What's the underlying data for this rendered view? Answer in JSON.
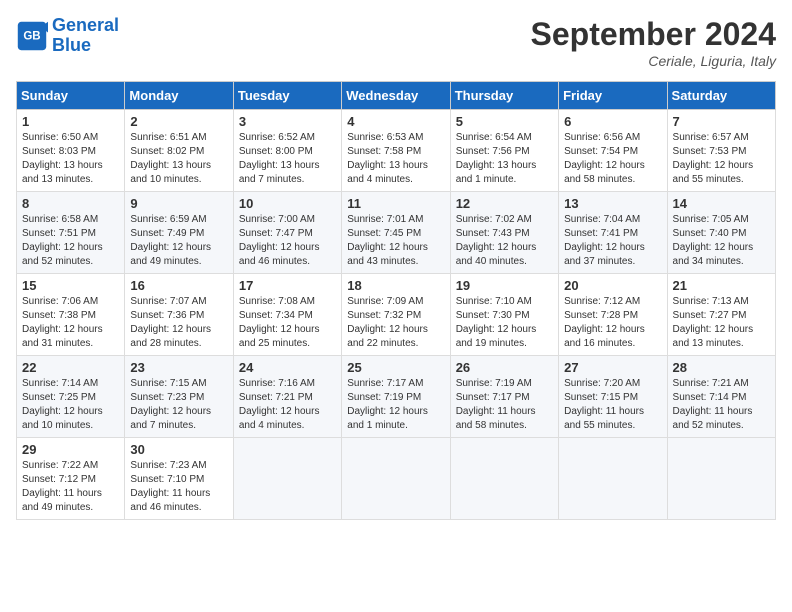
{
  "logo": {
    "line1": "General",
    "line2": "Blue"
  },
  "title": "September 2024",
  "location": "Ceriale, Liguria, Italy",
  "days_of_week": [
    "Sunday",
    "Monday",
    "Tuesday",
    "Wednesday",
    "Thursday",
    "Friday",
    "Saturday"
  ],
  "weeks": [
    [
      {
        "day": "1",
        "rise": "6:50 AM",
        "set": "8:03 PM",
        "daylight": "13 hours and 13 minutes."
      },
      {
        "day": "2",
        "rise": "6:51 AM",
        "set": "8:02 PM",
        "daylight": "13 hours and 10 minutes."
      },
      {
        "day": "3",
        "rise": "6:52 AM",
        "set": "8:00 PM",
        "daylight": "13 hours and 7 minutes."
      },
      {
        "day": "4",
        "rise": "6:53 AM",
        "set": "7:58 PM",
        "daylight": "13 hours and 4 minutes."
      },
      {
        "day": "5",
        "rise": "6:54 AM",
        "set": "7:56 PM",
        "daylight": "13 hours and 1 minute."
      },
      {
        "day": "6",
        "rise": "6:56 AM",
        "set": "7:54 PM",
        "daylight": "12 hours and 58 minutes."
      },
      {
        "day": "7",
        "rise": "6:57 AM",
        "set": "7:53 PM",
        "daylight": "12 hours and 55 minutes."
      }
    ],
    [
      {
        "day": "8",
        "rise": "6:58 AM",
        "set": "7:51 PM",
        "daylight": "12 hours and 52 minutes."
      },
      {
        "day": "9",
        "rise": "6:59 AM",
        "set": "7:49 PM",
        "daylight": "12 hours and 49 minutes."
      },
      {
        "day": "10",
        "rise": "7:00 AM",
        "set": "7:47 PM",
        "daylight": "12 hours and 46 minutes."
      },
      {
        "day": "11",
        "rise": "7:01 AM",
        "set": "7:45 PM",
        "daylight": "12 hours and 43 minutes."
      },
      {
        "day": "12",
        "rise": "7:02 AM",
        "set": "7:43 PM",
        "daylight": "12 hours and 40 minutes."
      },
      {
        "day": "13",
        "rise": "7:04 AM",
        "set": "7:41 PM",
        "daylight": "12 hours and 37 minutes."
      },
      {
        "day": "14",
        "rise": "7:05 AM",
        "set": "7:40 PM",
        "daylight": "12 hours and 34 minutes."
      }
    ],
    [
      {
        "day": "15",
        "rise": "7:06 AM",
        "set": "7:38 PM",
        "daylight": "12 hours and 31 minutes."
      },
      {
        "day": "16",
        "rise": "7:07 AM",
        "set": "7:36 PM",
        "daylight": "12 hours and 28 minutes."
      },
      {
        "day": "17",
        "rise": "7:08 AM",
        "set": "7:34 PM",
        "daylight": "12 hours and 25 minutes."
      },
      {
        "day": "18",
        "rise": "7:09 AM",
        "set": "7:32 PM",
        "daylight": "12 hours and 22 minutes."
      },
      {
        "day": "19",
        "rise": "7:10 AM",
        "set": "7:30 PM",
        "daylight": "12 hours and 19 minutes."
      },
      {
        "day": "20",
        "rise": "7:12 AM",
        "set": "7:28 PM",
        "daylight": "12 hours and 16 minutes."
      },
      {
        "day": "21",
        "rise": "7:13 AM",
        "set": "7:27 PM",
        "daylight": "12 hours and 13 minutes."
      }
    ],
    [
      {
        "day": "22",
        "rise": "7:14 AM",
        "set": "7:25 PM",
        "daylight": "12 hours and 10 minutes."
      },
      {
        "day": "23",
        "rise": "7:15 AM",
        "set": "7:23 PM",
        "daylight": "12 hours and 7 minutes."
      },
      {
        "day": "24",
        "rise": "7:16 AM",
        "set": "7:21 PM",
        "daylight": "12 hours and 4 minutes."
      },
      {
        "day": "25",
        "rise": "7:17 AM",
        "set": "7:19 PM",
        "daylight": "12 hours and 1 minute."
      },
      {
        "day": "26",
        "rise": "7:19 AM",
        "set": "7:17 PM",
        "daylight": "11 hours and 58 minutes."
      },
      {
        "day": "27",
        "rise": "7:20 AM",
        "set": "7:15 PM",
        "daylight": "11 hours and 55 minutes."
      },
      {
        "day": "28",
        "rise": "7:21 AM",
        "set": "7:14 PM",
        "daylight": "11 hours and 52 minutes."
      }
    ],
    [
      {
        "day": "29",
        "rise": "7:22 AM",
        "set": "7:12 PM",
        "daylight": "11 hours and 49 minutes."
      },
      {
        "day": "30",
        "rise": "7:23 AM",
        "set": "7:10 PM",
        "daylight": "11 hours and 46 minutes."
      },
      null,
      null,
      null,
      null,
      null
    ]
  ]
}
